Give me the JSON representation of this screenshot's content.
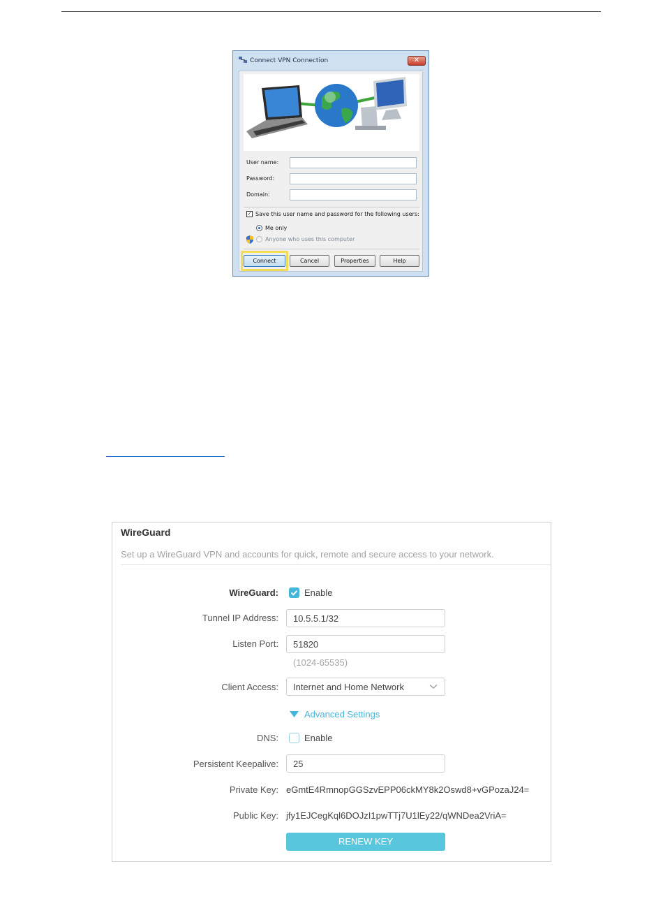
{
  "dialog": {
    "title": "Connect VPN Connection",
    "close_symbol": "✕",
    "labels": {
      "username": "User name:",
      "password": "Password:",
      "domain": "Domain:"
    },
    "save_credentials": "Save this user name and password for the following users:",
    "radio_me_only": "Me only",
    "radio_anyone": "Anyone who uses this computer",
    "buttons": {
      "connect": "Connect",
      "cancel": "Cancel",
      "properties": "Properties",
      "help": "Help"
    },
    "icons": [
      "network-connection-icon",
      "laptop-icon",
      "globe-icon",
      "desktop-computer-icon",
      "uac-shield-icon"
    ]
  },
  "wireguard": {
    "title": "WireGuard",
    "subtitle": "Set up a WireGuard VPN and accounts for quick, remote and secure access to your network.",
    "enable_label": "WireGuard:",
    "enable_text": "Enable",
    "tunnel_ip_label": "Tunnel IP Address:",
    "tunnel_ip_value": "10.5.5.1/32",
    "listen_port_label": "Listen Port:",
    "listen_port_value": "51820",
    "listen_port_hint": "(1024-65535)",
    "client_access_label": "Client Access:",
    "client_access_value": "Internet and Home Network",
    "advanced_settings": "Advanced Settings",
    "dns_label": "DNS:",
    "dns_text": "Enable",
    "keepalive_label": "Persistent Keepalive:",
    "keepalive_value": "25",
    "private_key_label": "Private Key:",
    "private_key_value": "eGmtE4RmnopGGSzvEPP06ckMY8k2Oswd8+vGPozaJ24=",
    "public_key_label": "Public Key:",
    "public_key_value": "jfy1EJCegKql6DOJzI1pwTTj7U1lEy22/qWNDea2VriA=",
    "renew_button": "RENEW KEY",
    "accent_color": "#45b6d9",
    "button_color": "#58c6dc"
  }
}
